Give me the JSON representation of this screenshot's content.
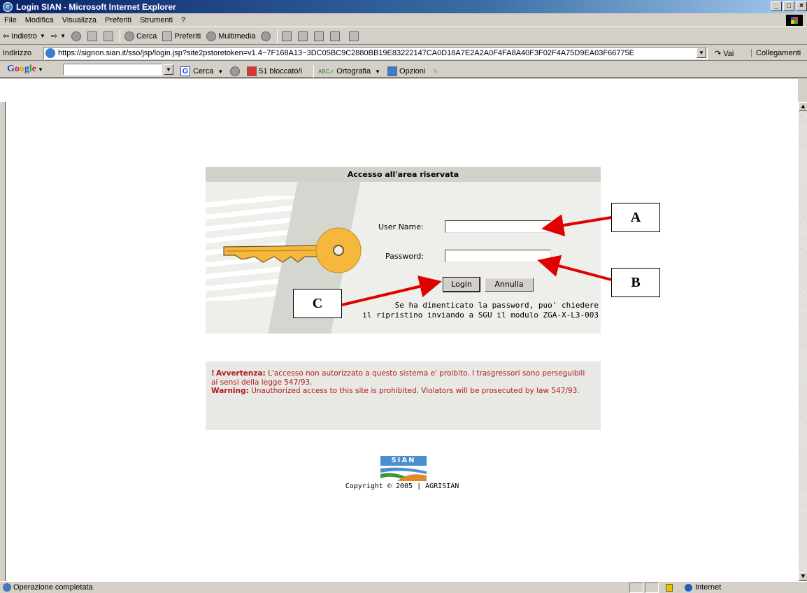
{
  "window": {
    "title": "Login SIAN - Microsoft Internet Explorer",
    "buttons": [
      "_",
      "□",
      "×"
    ]
  },
  "menu": [
    "File",
    "Modifica",
    "Visualizza",
    "Preferiti",
    "Strumenti",
    "?"
  ],
  "toolbar": {
    "back": "Indietro",
    "search": "Cerca",
    "favorites": "Preferiti",
    "media": "Multimedia"
  },
  "address": {
    "label": "Indirizzo",
    "url": "https://signon.sian.it/sso/jsp/login.jsp?site2pstoretoken=v1.4~7F168A13~3DC05BC9C2880BB19E83222147CA0D18A7E2A2A0F4FA8A40F3F02F4A75D9EA03F66775E",
    "go": "Vai",
    "links": "Collegamenti"
  },
  "google": {
    "logo": "Google",
    "search": "Cerca",
    "blocked": "51 bloccato/i",
    "spell": "Ortografia",
    "options": "Opzioni"
  },
  "login": {
    "header": "Accesso all'area riservata",
    "username_label": "User Name:",
    "username_value": "",
    "password_label": "Password:",
    "password_value": "",
    "login_button": "Login",
    "cancel_button": "Annulla",
    "forgot_line1": "Se ha dimenticato la password, puo' chiedere",
    "forgot_line2": "il ripristino inviando a SGU il modulo ZGA-X-L3-003"
  },
  "warning": {
    "label_it": "Avvertenza:",
    "text_it": " L'accesso non autorizzato a questo sistema e' proibito. I trasgressori sono perseguibili ai sensi della legge 547/93.",
    "label_en": "Warning:",
    "text_en": " Unauthorized access to this site is prohibited. Violators will be prosecuted by law 547/93."
  },
  "footer": {
    "logo_text": "SIAN",
    "copyright": "Copyright © 2005 | AGRISIAN"
  },
  "callouts": {
    "a": "A",
    "b": "B",
    "c": "C"
  },
  "status": {
    "text": "Operazione completata",
    "zone": "Internet"
  },
  "colors": {
    "arrow": "#e00000",
    "key": "#f5b83d",
    "warning_text": "#b11a1a"
  }
}
